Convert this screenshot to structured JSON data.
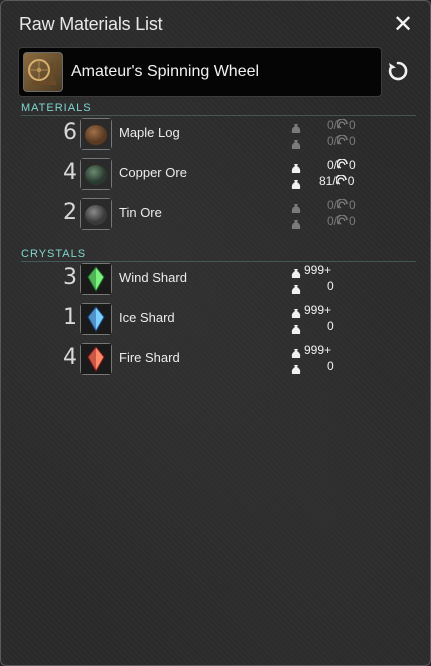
{
  "window": {
    "title": "Raw Materials List",
    "close_label": "✕"
  },
  "recipe": {
    "name": "Amateur's Spinning Wheel"
  },
  "sections": {
    "materials": "MATERIALS",
    "crystals": "CRYSTALS"
  },
  "materials": [
    {
      "qty": "6",
      "name": "Maple Log",
      "nq_text": "0/",
      "hq_text": "0",
      "nq_have_text": "0/",
      "hq_have_text": "0",
      "bright": false,
      "icon_color_a": "#a0704a",
      "icon_color_b": "#5a3a22"
    },
    {
      "qty": "4",
      "name": "Copper Ore",
      "nq_text": "0/",
      "hq_text": "0",
      "nq_have_text": "81/",
      "hq_have_text": "0",
      "bright": true,
      "icon_color_a": "#6a8a70",
      "icon_color_b": "#2a3a30"
    },
    {
      "qty": "2",
      "name": "Tin Ore",
      "nq_text": "0/",
      "hq_text": "0",
      "nq_have_text": "0/",
      "hq_have_text": "0",
      "bright": false,
      "icon_color_a": "#8a8a8a",
      "icon_color_b": "#3a3a3a"
    }
  ],
  "crystals": [
    {
      "qty": "3",
      "name": "Wind Shard",
      "top": "999+",
      "bottom": "0",
      "icon_color_a": "#7cf07c",
      "icon_color_b": "#1c6a2a"
    },
    {
      "qty": "1",
      "name": "Ice Shard",
      "top": "999+",
      "bottom": "0",
      "icon_color_a": "#7cd0ff",
      "icon_color_b": "#1a4a8a"
    },
    {
      "qty": "4",
      "name": "Fire Shard",
      "top": "999+",
      "bottom": "0",
      "icon_color_a": "#ff8a6a",
      "icon_color_b": "#8a1a1a"
    }
  ],
  "colors": {
    "accent": "#7fd6d0",
    "dim_text": "#7a7a7a",
    "bright_text": "#f0f0f0"
  }
}
